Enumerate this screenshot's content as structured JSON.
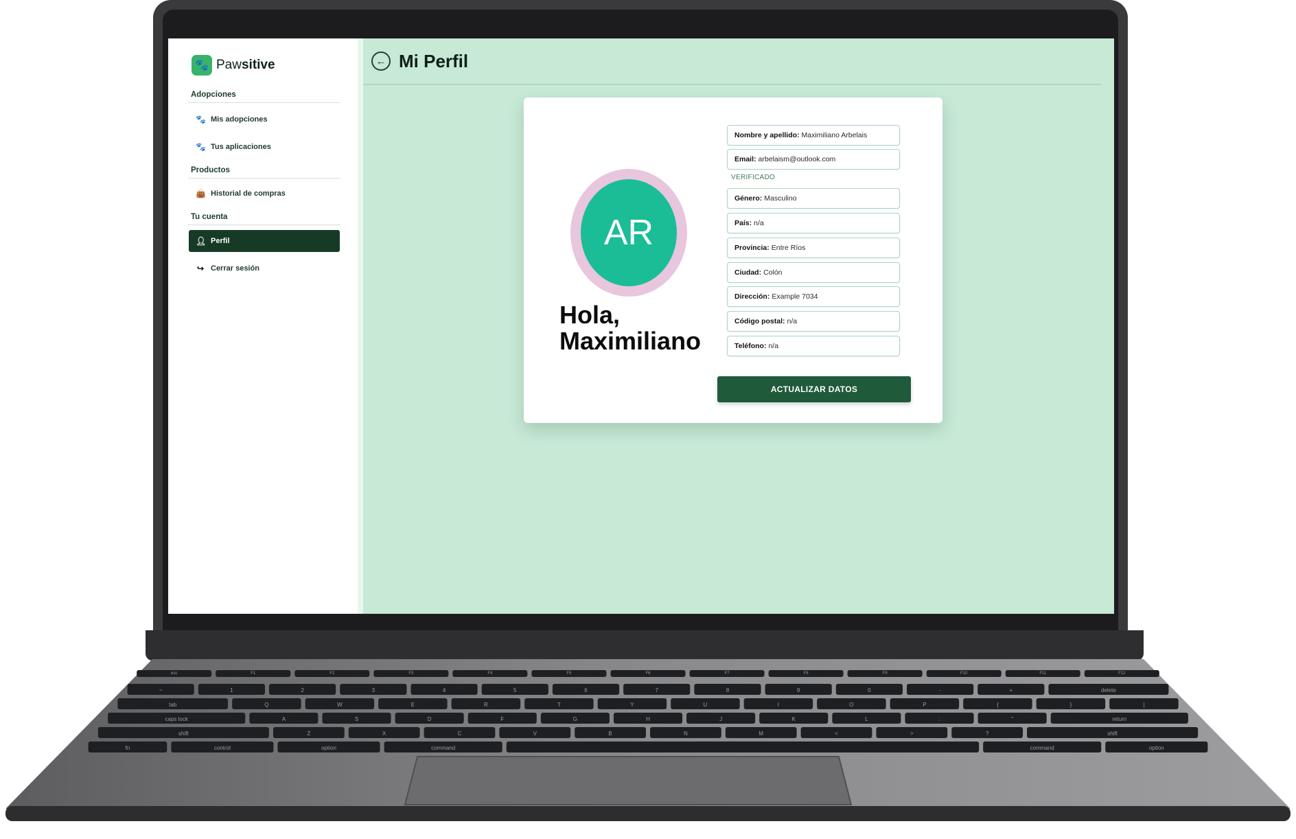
{
  "app": {
    "brand_light": "Paw",
    "brand_bold": "sitive",
    "logo_icon": "paw-icon",
    "accent": "#1f5a3b",
    "background": "#c7e9d6"
  },
  "sidebar": {
    "sections": [
      {
        "title": "Adopciones",
        "items": [
          {
            "label": "Mis adopciones",
            "icon": "paw-icon"
          },
          {
            "label": "Tus aplicaciones",
            "icon": "paw-icon"
          }
        ]
      },
      {
        "title": "Productos",
        "items": [
          {
            "label": "Historial de compras",
            "icon": "bag-icon"
          }
        ]
      },
      {
        "title": "Tu cuenta",
        "items": [
          {
            "label": "Perfil",
            "icon": "user-icon",
            "active": true
          },
          {
            "label": "Cerrar sesión",
            "icon": "logout-icon"
          }
        ]
      }
    ]
  },
  "header": {
    "back_icon": "arrow-left-icon",
    "title": "Mi Perfil"
  },
  "profile": {
    "initials": "AR",
    "greeting_line1": "Hola,",
    "greeting_line2": "Maximiliano",
    "verified_label": "VERIFICADO",
    "fields": [
      {
        "label": "Nombre y apellido:",
        "value": "Maximiliano Arbelais"
      },
      {
        "label": "Email:",
        "value": "arbelaism@outlook.com"
      },
      {
        "label": "Género:",
        "value": "Masculino"
      },
      {
        "label": "País:",
        "value": "n/a"
      },
      {
        "label": "Provincia:",
        "value": "Entre Ríos"
      },
      {
        "label": "Ciudad:",
        "value": "Colón"
      },
      {
        "label": "Dirección:",
        "value": "Example 7034"
      },
      {
        "label": "Código postal:",
        "value": "n/a"
      },
      {
        "label": "Teléfono:",
        "value": "n/a"
      }
    ],
    "submit_label": "ACTUALIZAR DATOS"
  },
  "keyboard": {
    "rows": [
      [
        "esc",
        "F1",
        "F2",
        "F3",
        "F4",
        "F5",
        "F6",
        "F7",
        "F8",
        "F9",
        "F10",
        "F11",
        "F12"
      ],
      [
        "~",
        "1",
        "2",
        "3",
        "4",
        "5",
        "6",
        "7",
        "8",
        "9",
        "0",
        "-",
        "+",
        "delete"
      ],
      [
        "tab",
        "Q",
        "W",
        "E",
        "R",
        "T",
        "Y",
        "U",
        "I",
        "O",
        "P",
        "{",
        "}",
        "|"
      ],
      [
        "caps lock",
        "A",
        "S",
        "D",
        "F",
        "G",
        "H",
        "J",
        "K",
        "L",
        ":",
        "\"",
        "return"
      ],
      [
        "shift",
        "Z",
        "X",
        "C",
        "V",
        "B",
        "N",
        "M",
        "<",
        ">",
        "?",
        "shift"
      ],
      [
        "fn",
        "control",
        "option",
        "command",
        "",
        "command",
        "option"
      ]
    ]
  }
}
